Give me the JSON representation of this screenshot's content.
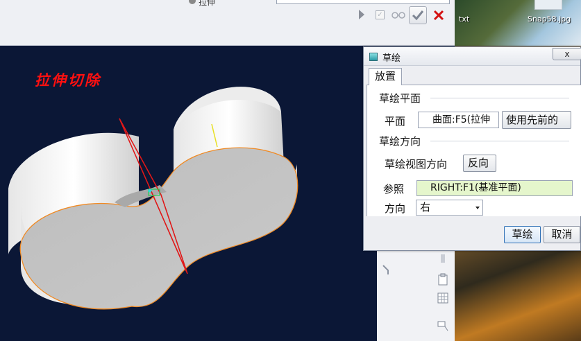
{
  "dashboard": {
    "field_label": "拉伸",
    "field_value": "",
    "ok_icon": "checkmark-icon",
    "cancel_icon": "red-x-icon"
  },
  "desktop": {
    "file1": "txt",
    "file2": "Snap58.jpg"
  },
  "viewport": {
    "feature_title": "拉伸切除"
  },
  "dialog": {
    "title": "草绘",
    "close_label": "x",
    "tab": "放置",
    "sketch_plane": {
      "section_title": "草绘平面",
      "plane_label": "平面",
      "plane_value": "曲面:F5(拉伸",
      "use_previous_label": "使用先前的"
    },
    "sketch_orientation": {
      "section_title": "草绘方向",
      "view_direction_label": "草绘视图方向",
      "flip_label": "反向",
      "reference_label": "参照",
      "reference_value": "RIGHT:F1(基准平面)",
      "direction_label": "方向",
      "direction_value": "右"
    },
    "buttons": {
      "sketch": "草绘",
      "cancel": "取消"
    }
  },
  "colors": {
    "viewport_bg": "#0b1736",
    "title_red": "#ff1010",
    "edge_orange": "#f08a24",
    "sketch_red": "#e01818",
    "reference_green": "#e5f6cc"
  }
}
